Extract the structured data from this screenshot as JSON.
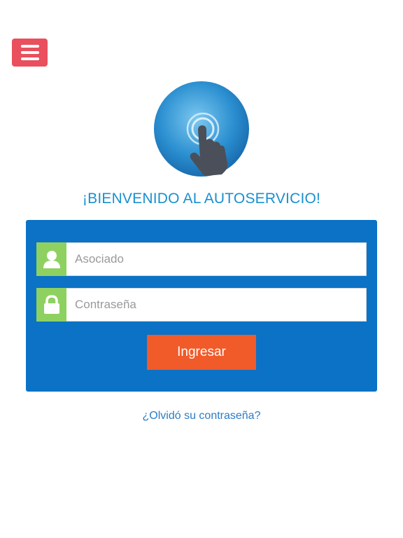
{
  "menu": {
    "icon": "hamburger-menu-icon",
    "color": "#e94f5d"
  },
  "logo": {
    "icon": "touch-hand-icon",
    "circle_color": "#2b8fd0"
  },
  "welcome": {
    "title": "¡BIENVENIDO AL AUTOSERVICIO!"
  },
  "login": {
    "panel_color": "#0b72c6",
    "user_field": {
      "icon": "user-icon",
      "placeholder": "Asociado",
      "value": ""
    },
    "password_field": {
      "icon": "lock-icon",
      "placeholder": "Contraseña",
      "value": ""
    },
    "submit_label": "Ingresar",
    "submit_color": "#f15a29"
  },
  "forgot_password": {
    "label": "¿Olvidó su contraseña?"
  }
}
